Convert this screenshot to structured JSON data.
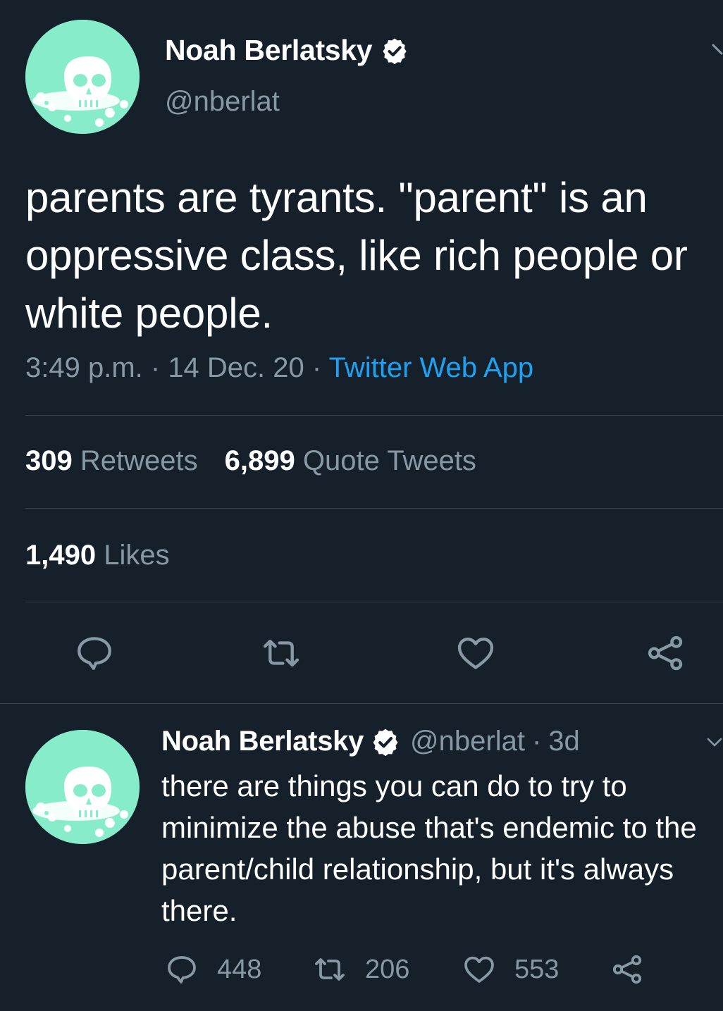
{
  "main_tweet": {
    "author_name": "Noah Berlatsky",
    "handle": "@nberlat",
    "text": "parents are tyrants. \"parent\" is an oppressive class, like rich people or white people.",
    "time": "3:49 p.m.",
    "date": "14 Dec. 20",
    "separator": " · ",
    "source": "Twitter Web App",
    "retweets": {
      "count": "309",
      "label": "Retweets"
    },
    "quote_tweets": {
      "count": "6,899",
      "label": "Quote Tweets"
    },
    "likes": {
      "count": "1,490",
      "label": "Likes"
    }
  },
  "reply_tweet": {
    "author_name": "Noah Berlatsky",
    "handle": "@nberlat",
    "separator": "·",
    "age": "3d",
    "text": "there are things you can do to try to minimize the abuse that's endemic to the parent/child relationship, but it's always there.",
    "replies": "448",
    "retweets": "206",
    "likes": "553"
  },
  "colors": {
    "background": "#15202b",
    "primary_text": "#ffffff",
    "secondary_text": "#8899a6",
    "link": "#1da1f2",
    "divider": "#38444d",
    "avatar_bg": "#86ecc9"
  },
  "icons": [
    "verified-badge-icon",
    "chevron-down-icon",
    "reply-icon",
    "retweet-icon",
    "like-icon",
    "share-icon",
    "skull-avatar"
  ]
}
